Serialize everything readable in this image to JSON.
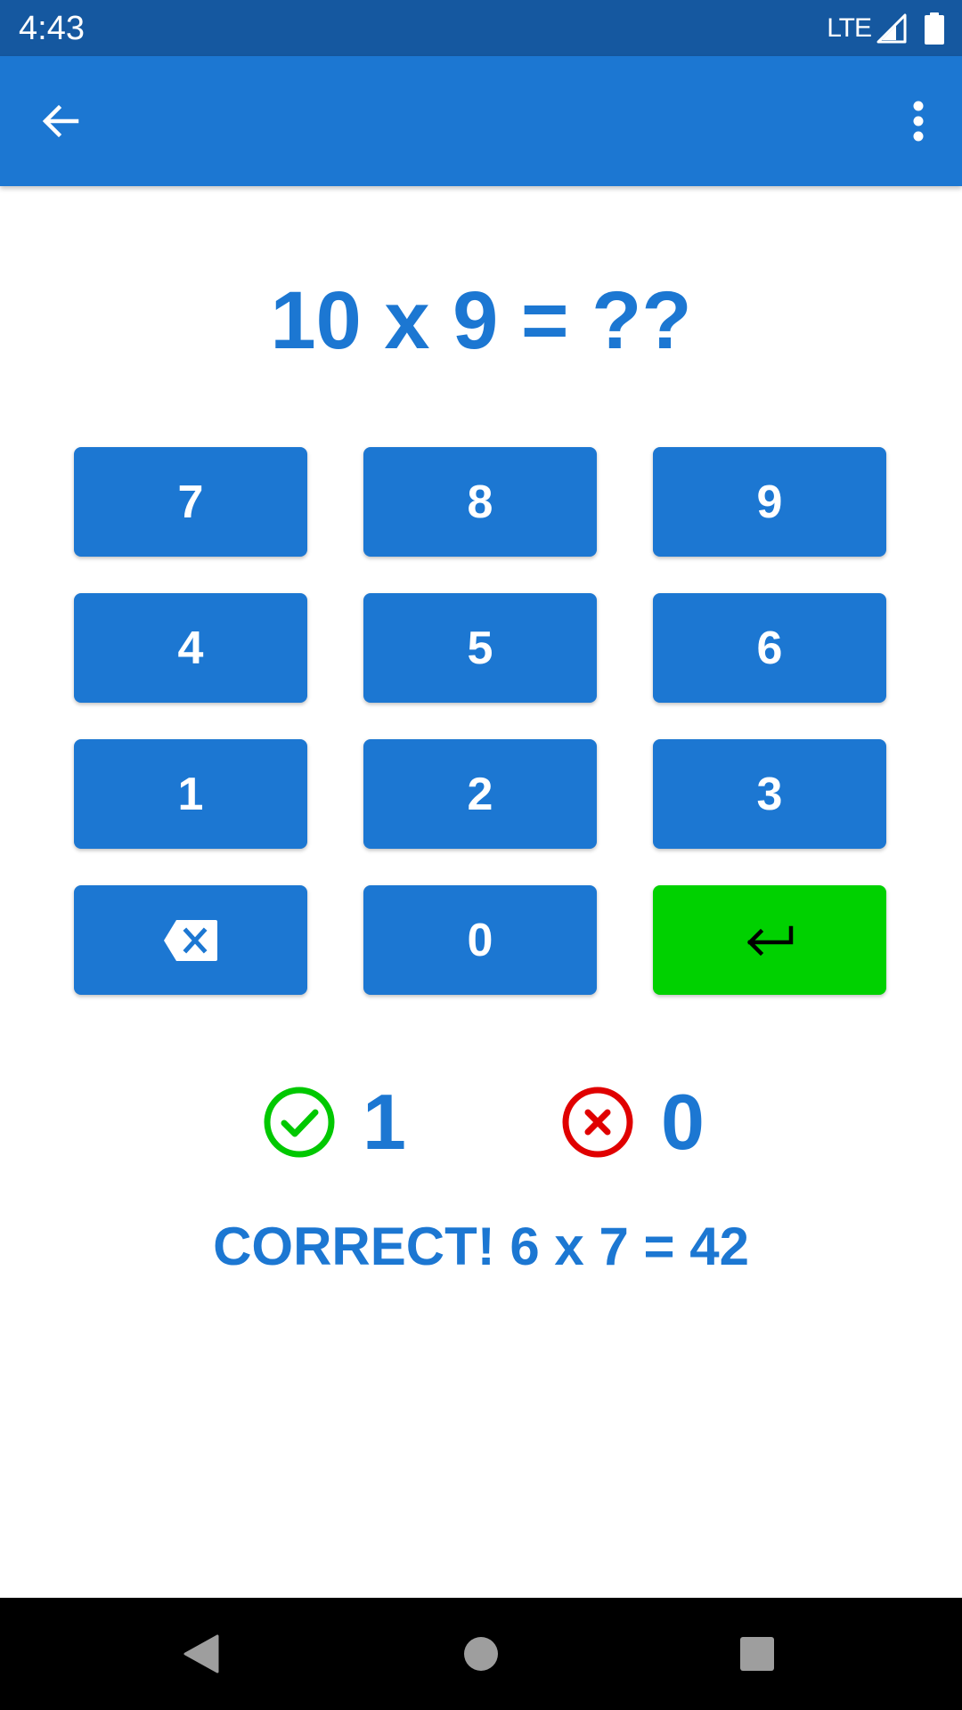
{
  "status_bar": {
    "time": "4:43",
    "network": "LTE",
    "icons": [
      "signal-icon",
      "battery-icon"
    ]
  },
  "app_bar": {
    "icons": [
      "arrow-back-icon",
      "more-vert-icon"
    ]
  },
  "question": {
    "text": "10 x 9 = ??"
  },
  "keypad": {
    "keys": [
      "7",
      "8",
      "9",
      "4",
      "5",
      "6",
      "1",
      "2",
      "3",
      "backspace-icon",
      "0",
      "enter-icon"
    ]
  },
  "score": {
    "correct": "1",
    "wrong": "0",
    "correct_icon": "check-circle-icon",
    "wrong_icon": "x-circle-icon"
  },
  "feedback": {
    "text": "CORRECT! 6 x 7 = 42"
  },
  "nav_bar": {
    "icons": [
      "nav-back-icon",
      "nav-home-icon",
      "nav-recents-icon"
    ]
  },
  "colors": {
    "status_bar": "#1558a0",
    "primary": "#1c77d2",
    "enter": "#00d100",
    "correct": "#00c800",
    "wrong": "#e00000"
  }
}
